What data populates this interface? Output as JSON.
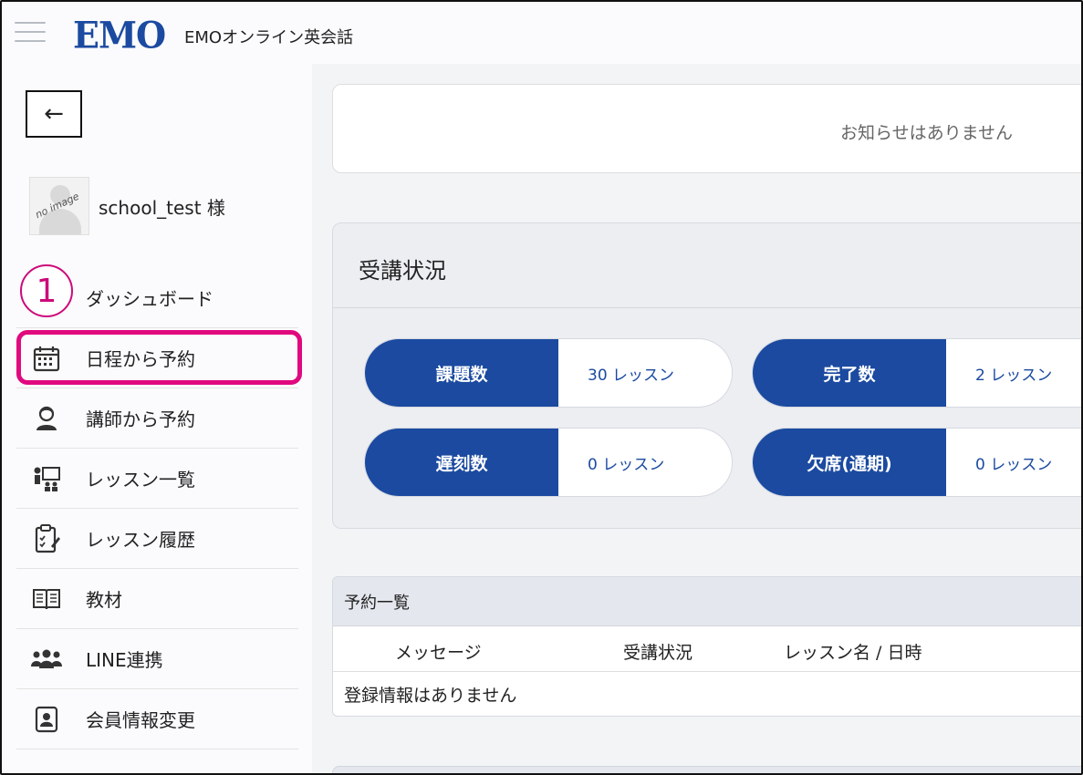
{
  "header": {
    "logo": "EMO",
    "app_name": "EMOオンライン英会話"
  },
  "sidebar": {
    "back_label": "←",
    "user": {
      "name": "school_test 様",
      "avatar_text": "no image"
    },
    "annotation_number": "1",
    "items": [
      {
        "label": "ダッシュボード",
        "icon": "home-icon"
      },
      {
        "label": "日程から予約",
        "icon": "calendar-icon"
      },
      {
        "label": "講師から予約",
        "icon": "teacher-icon"
      },
      {
        "label": "レッスン一覧",
        "icon": "lesson-list-icon"
      },
      {
        "label": "レッスン履歴",
        "icon": "clipboard-icon"
      },
      {
        "label": "教材",
        "icon": "book-icon"
      },
      {
        "label": "LINE連携",
        "icon": "users-icon"
      },
      {
        "label": "会員情報変更",
        "icon": "profile-icon"
      }
    ]
  },
  "main": {
    "notice": "お知らせはありません",
    "status": {
      "title": "受講状況",
      "stats": [
        {
          "label": "課題数",
          "value": "30 レッスン"
        },
        {
          "label": "完了数",
          "value": "2 レッスン"
        },
        {
          "label": "遅刻数",
          "value": "0 レッスン"
        },
        {
          "label": "欠席(通期)",
          "value": "0 レッスン"
        }
      ]
    },
    "reservations": {
      "title": "予約一覧",
      "columns": [
        "メッセージ",
        "受講状況",
        "レッスン名 / 日時"
      ],
      "empty": "登録情報はありません"
    }
  },
  "colors": {
    "brand": "#1b4aa0",
    "highlight": "#e0097e"
  }
}
